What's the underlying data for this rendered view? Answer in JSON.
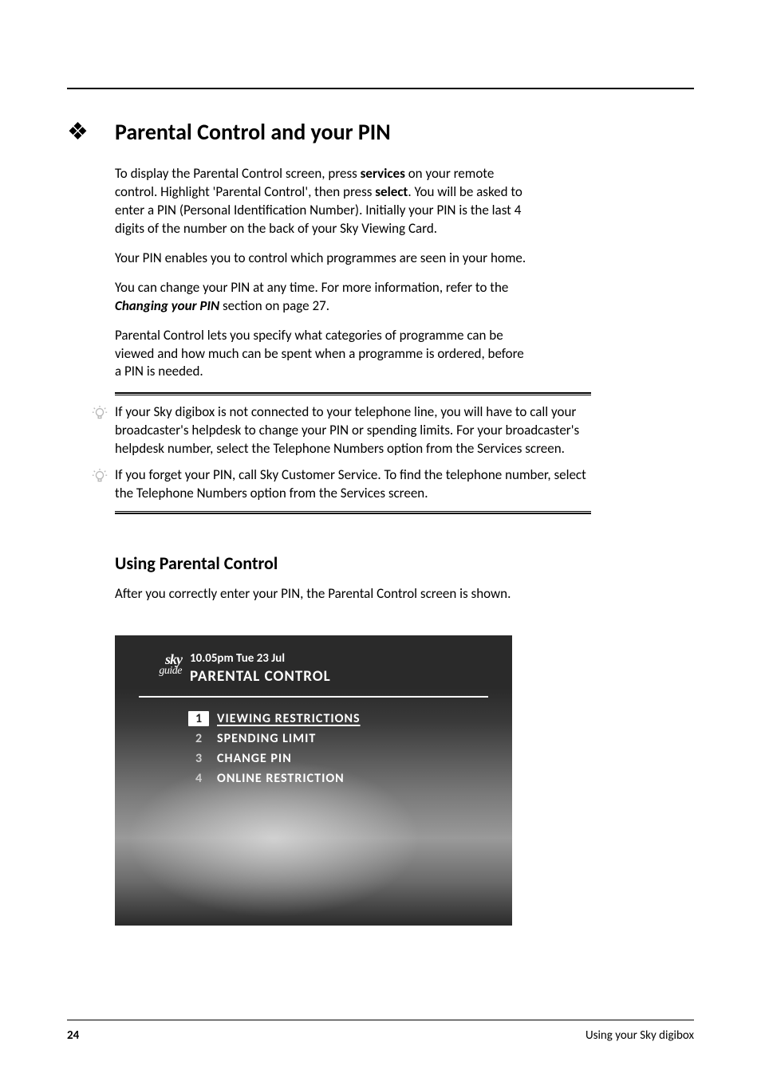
{
  "heading": "Parental Control and your PIN",
  "para1": {
    "pre": "To display the Parental Control screen, press ",
    "b1": "services",
    "mid1": " on your remote control.  Highlight 'Parental Control', then press ",
    "b2": "select",
    "post": ".  You will be asked to enter a PIN (Personal Identification Number).  Initially your PIN is the last 4 digits of the number on the back of your Sky Viewing Card."
  },
  "para2": "Your PIN enables you to control which programmes are seen in your home.",
  "para3": {
    "pre": "You can change your PIN at any time.  For more information, refer to the ",
    "em": "Changing your PIN",
    "post": " section on page 27."
  },
  "para4": "Parental Control lets you specify what categories of programme can be viewed and how much can be spent when a programme is ordered, before a PIN is needed.",
  "tip1": "If your Sky digibox is not connected to your telephone line, you will have to call your broadcaster's helpdesk to change your PIN or spending limits.  For your broadcaster's helpdesk number, select the Telephone Numbers option from the Services screen.",
  "tip2": "If you forget your PIN, call Sky Customer Service.  To find the telephone number, select the Telephone Numbers option from the Services screen.",
  "subheading": "Using Parental Control",
  "para5": "After you correctly enter your PIN, the Parental Control screen is shown.",
  "screen": {
    "brand": "sky",
    "brand_sub": "guide",
    "time": "10.05pm Tue 23 Jul",
    "title": "PARENTAL CONTROL",
    "items": [
      {
        "n": "1",
        "label": "VIEWING RESTRICTIONS"
      },
      {
        "n": "2",
        "label": "SPENDING LIMIT"
      },
      {
        "n": "3",
        "label": "CHANGE PIN"
      },
      {
        "n": "4",
        "label": "ONLINE RESTRICTION"
      }
    ]
  },
  "footer": {
    "page": "24",
    "label": "Using your Sky digibox"
  }
}
